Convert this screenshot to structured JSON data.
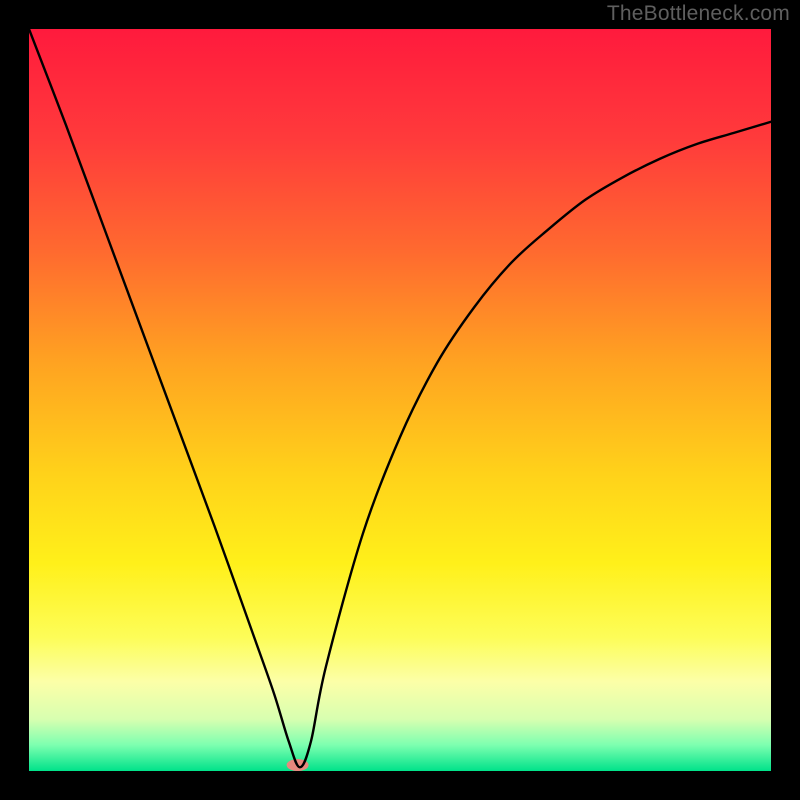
{
  "watermark": "TheBottleneck.com",
  "chart_data": {
    "type": "line",
    "title": "",
    "xlabel": "",
    "ylabel": "",
    "xlim": [
      0,
      100
    ],
    "ylim": [
      0,
      100
    ],
    "background_gradient": {
      "stops": [
        {
          "offset": 0.0,
          "color": "#ff1a3d"
        },
        {
          "offset": 0.15,
          "color": "#ff3b3b"
        },
        {
          "offset": 0.3,
          "color": "#ff6a2f"
        },
        {
          "offset": 0.45,
          "color": "#ffa321"
        },
        {
          "offset": 0.6,
          "color": "#ffd21a"
        },
        {
          "offset": 0.72,
          "color": "#fff01a"
        },
        {
          "offset": 0.82,
          "color": "#fdfd58"
        },
        {
          "offset": 0.88,
          "color": "#fcffa8"
        },
        {
          "offset": 0.93,
          "color": "#d8ffb0"
        },
        {
          "offset": 0.965,
          "color": "#7dffb0"
        },
        {
          "offset": 1.0,
          "color": "#00e28a"
        }
      ]
    },
    "series": [
      {
        "name": "bottleneck-curve",
        "color": "#000000",
        "x": [
          0,
          5,
          10,
          15,
          20,
          25,
          30,
          33,
          35,
          36.5,
          38,
          40,
          45,
          50,
          55,
          60,
          65,
          70,
          75,
          80,
          85,
          90,
          95,
          100
        ],
        "y": [
          100,
          87,
          73.5,
          60,
          46.5,
          33,
          19,
          10.5,
          4,
          0.5,
          4,
          14,
          32,
          45,
          55,
          62.5,
          68.5,
          73,
          77,
          80,
          82.5,
          84.5,
          86,
          87.5
        ]
      }
    ],
    "markers": [
      {
        "name": "minimum-marker",
        "x": 36.2,
        "y": 0.8,
        "color": "#e8887e",
        "rx": 11,
        "ry": 6
      }
    ]
  }
}
